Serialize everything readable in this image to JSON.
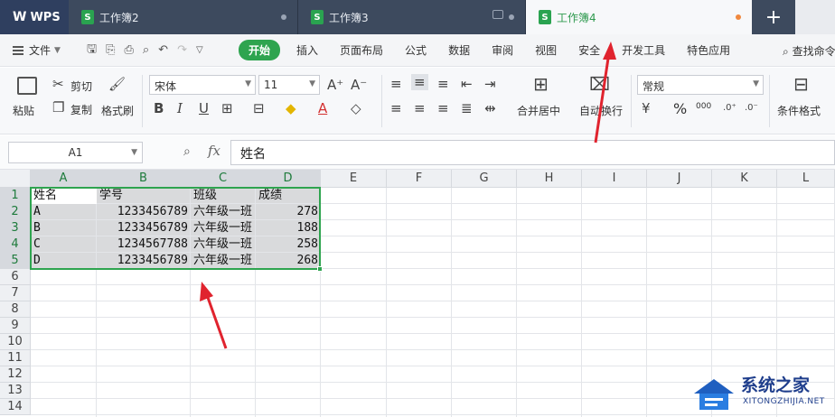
{
  "tabs": {
    "logo": "WPS",
    "docs": [
      {
        "label": "工作簿2",
        "icon": "S"
      },
      {
        "label": "工作簿3",
        "icon": "S"
      },
      {
        "label": "工作簿4",
        "icon": "S"
      }
    ],
    "new_tab": "+"
  },
  "menu": {
    "file": "文件",
    "items": [
      "开始",
      "插入",
      "页面布局",
      "公式",
      "数据",
      "审阅",
      "视图",
      "安全",
      "开发工具",
      "特色应用"
    ],
    "search": "查找命令"
  },
  "ribbon": {
    "paste": "粘贴",
    "cut": "剪切",
    "copy": "复制",
    "format_painter": "格式刷",
    "font_name": "宋体",
    "font_size": "11",
    "merge_center": "合并居中",
    "auto_wrap": "自动换行",
    "number_format": "常规",
    "conditional_format": "条件格式",
    "percent": "%",
    "thousands": "000"
  },
  "formula_bar": {
    "name_box": "A1",
    "fx": "fx",
    "content": "姓名"
  },
  "grid": {
    "columns": [
      "A",
      "B",
      "C",
      "D",
      "E",
      "F",
      "G",
      "H",
      "I",
      "J",
      "K",
      "L"
    ],
    "rows": [
      "1",
      "2",
      "3",
      "4",
      "5",
      "6",
      "7",
      "8",
      "9",
      "10",
      "11",
      "12",
      "13",
      "14"
    ],
    "cells": [
      [
        "姓名",
        "学号",
        "班级",
        "成绩"
      ],
      [
        "A",
        "1233456789",
        "六年级一班",
        "278"
      ],
      [
        "B",
        "1233456789",
        "六年级一班",
        "188"
      ],
      [
        "C",
        "1234567788",
        "六年级一班",
        "258"
      ],
      [
        "D",
        "1233456789",
        "六年级一班",
        "268"
      ]
    ]
  },
  "watermark": {
    "title": "系统之家",
    "subtitle": "XITONGZHIJIA.NET"
  },
  "colors": {
    "accent": "#2ea44f",
    "arrow": "#e0232e",
    "tab_dark": "#3d4a5e"
  }
}
